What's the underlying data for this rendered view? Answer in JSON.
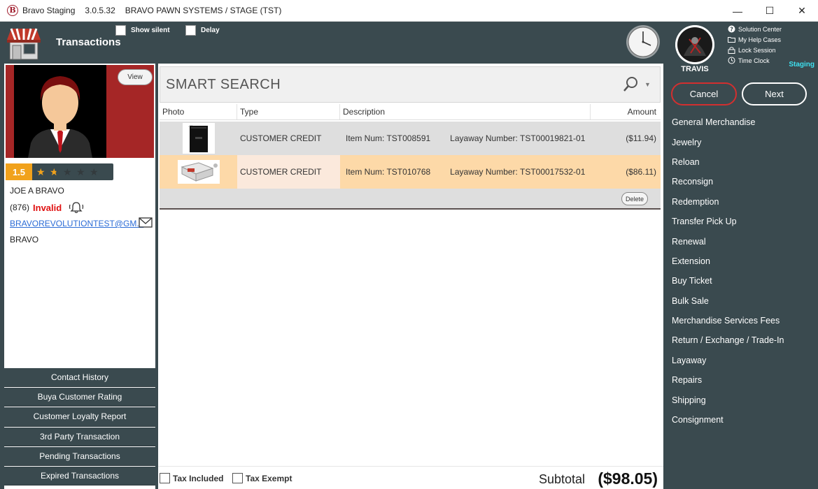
{
  "window": {
    "app_name": "Bravo Staging",
    "version": "3.0.5.32",
    "context": "BRAVO PAWN SYSTEMS / STAGE (TST)",
    "logo_letter": "B",
    "minimize": "—",
    "maximize": "☐",
    "close": "✕"
  },
  "header": {
    "title": "Transactions",
    "show_silent_label": "Show silent",
    "delay_label": "Delay"
  },
  "user": {
    "name": "TRAVIS",
    "environment": "Staging",
    "links": [
      "Solution Center",
      "My Help Cases",
      "Lock Session",
      "Time Clock"
    ]
  },
  "actions": {
    "cancel": "Cancel",
    "next": "Next"
  },
  "menu": [
    "General Merchandise",
    "Jewelry",
    "Reloan",
    "Reconsign",
    "Redemption",
    "Transfer Pick Up",
    "Renewal",
    "Extension",
    "Buy Ticket",
    "Bulk Sale",
    "Merchandise Services Fees",
    "Return / Exchange / Trade-In",
    "Layaway",
    "Repairs",
    "Shipping",
    "Consignment"
  ],
  "customer": {
    "view_label": "View",
    "rating": "1.5",
    "rating_value": 1.5,
    "rating_max": 5,
    "name": "JOE A BRAVO",
    "phone_area": "(876)",
    "phone_status": "Invalid",
    "email": "BRAVOREVOLUTIONTEST@GM...",
    "company": "BRAVO"
  },
  "side_buttons": [
    "Contact History",
    "Buya Customer Rating",
    "Customer Loyalty Report",
    "3rd Party Transaction",
    "Pending Transactions",
    "Expired Transactions"
  ],
  "search": {
    "placeholder": "SMART SEARCH"
  },
  "grid": {
    "headers": [
      "Photo",
      "Type",
      "Description",
      "Amount"
    ],
    "rows": [
      {
        "type": "CUSTOMER CREDIT",
        "item": "Item Num: TST008591",
        "layaway": "Layaway Number: TST00019821-01",
        "amount": "($11.94)"
      },
      {
        "type": "CUSTOMER CREDIT",
        "item": "Item Num: TST010768",
        "layaway": "Layaway Number: TST00017532-01",
        "amount": "($86.11)"
      }
    ],
    "delete_label": "Delete"
  },
  "footer": {
    "tax_included": "Tax Included",
    "tax_exempt": "Tax Exempt",
    "subtotal_label": "Subtotal",
    "subtotal_value": "($98.05)"
  },
  "colors": {
    "panel": "#3a4a4f",
    "accent_orange": "#f1a21c",
    "cancel_red": "#d32f2f",
    "selected_row": "#fdd9a8",
    "staging_cyan": "#3ee0f0"
  }
}
